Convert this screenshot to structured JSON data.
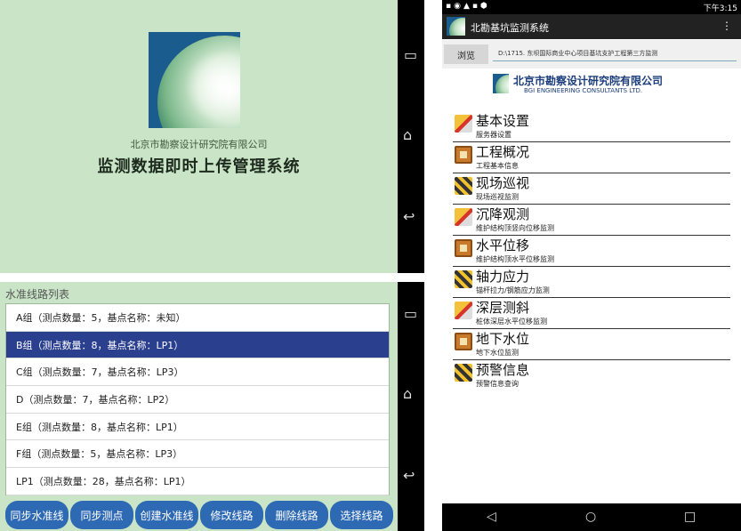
{
  "screenA": {
    "org_name": "北京市勘察设计研究院有限公司",
    "system_title": "监测数据即时上传管理系统"
  },
  "screenB": {
    "list_title": "水准线路列表",
    "rows": [
      {
        "label": "A组（测点数量：5，基点名称：未知）",
        "selected": false
      },
      {
        "label": "B组（测点数量：8，基点名称：LP1）",
        "selected": true
      },
      {
        "label": "C组（测点数量：7，基点名称：LP3）",
        "selected": false
      },
      {
        "label": "D（测点数量：7，基点名称：LP2）",
        "selected": false
      },
      {
        "label": "E组（测点数量：8，基点名称：LP1）",
        "selected": false
      },
      {
        "label": "F组（测点数量：5，基点名称：LP3）",
        "selected": false
      },
      {
        "label": "LP1（测点数量：28，基点名称：LP1）",
        "selected": false
      }
    ],
    "buttons": [
      "同步水准线",
      "同步测点",
      "创建水准线",
      "修改线路",
      "删除线路",
      "选择线路"
    ]
  },
  "screenC": {
    "status_time": "下午3:15",
    "app_title": "北勘基坑监测系统",
    "browse_label": "浏览",
    "path_value": "D:\\1715. 东坝国际商业中心项目基坑支护工程第三方监测",
    "company_cn": "北京市勘察设计研究院有限公司",
    "company_en": "BGI ENGINEERING CONSULTANTS LTD.",
    "menu": [
      {
        "title": "基本设置",
        "sub": "服务器设置",
        "icon": "pencil-icon"
      },
      {
        "title": "工程概况",
        "sub": "工程基本信息",
        "icon": "book-icon"
      },
      {
        "title": "现场巡视",
        "sub": "现场巡视监测",
        "icon": "barrier-icon"
      },
      {
        "title": "沉降观测",
        "sub": "维护结构顶竖向位移监测",
        "icon": "pencil-icon"
      },
      {
        "title": "水平位移",
        "sub": "维护结构顶水平位移监测",
        "icon": "book-icon"
      },
      {
        "title": "轴力应力",
        "sub": "锚杆拉力/钢筋应力监测",
        "icon": "barrier-icon"
      },
      {
        "title": "深层测斜",
        "sub": "桩体深层水平位移监测",
        "icon": "pencil-icon"
      },
      {
        "title": "地下水位",
        "sub": "地下水位监测",
        "icon": "book-icon"
      },
      {
        "title": "预警信息",
        "sub": "预警信息查询",
        "icon": "barrier-icon"
      }
    ]
  }
}
